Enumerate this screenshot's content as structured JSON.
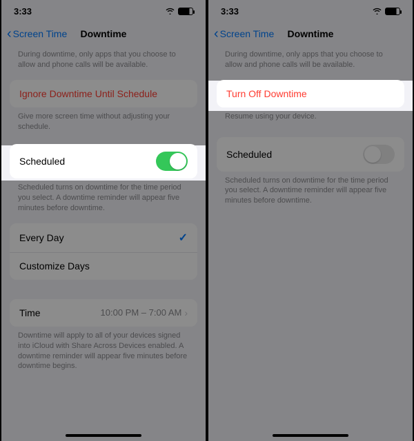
{
  "statusbar": {
    "time": "3:33",
    "battery": "78"
  },
  "nav": {
    "back": "Screen Time",
    "title": "Downtime"
  },
  "left": {
    "intro": "During downtime, only apps that you choose to allow and phone calls will be available.",
    "ignore": "Ignore Downtime Until Schedule",
    "ignore_footer": "Give more screen time without adjusting your schedule.",
    "scheduled": "Scheduled",
    "scheduled_footer": "Scheduled turns on downtime for the time period you select. A downtime reminder will appear five minutes before downtime.",
    "every_day": "Every Day",
    "customize": "Customize Days",
    "time_label": "Time",
    "time_value": "10:00 PM – 7:00 AM",
    "time_footer": "Downtime will apply to all of your devices signed into iCloud with Share Across Devices enabled. A downtime reminder will appear five minutes before downtime begins."
  },
  "right": {
    "turn_off": "Turn Off Downtime",
    "turn_off_footer": "Resume using your device.",
    "scheduled": "Scheduled",
    "scheduled_footer": "Scheduled turns on downtime for the time period you select. A downtime reminder will appear five minutes before downtime."
  }
}
